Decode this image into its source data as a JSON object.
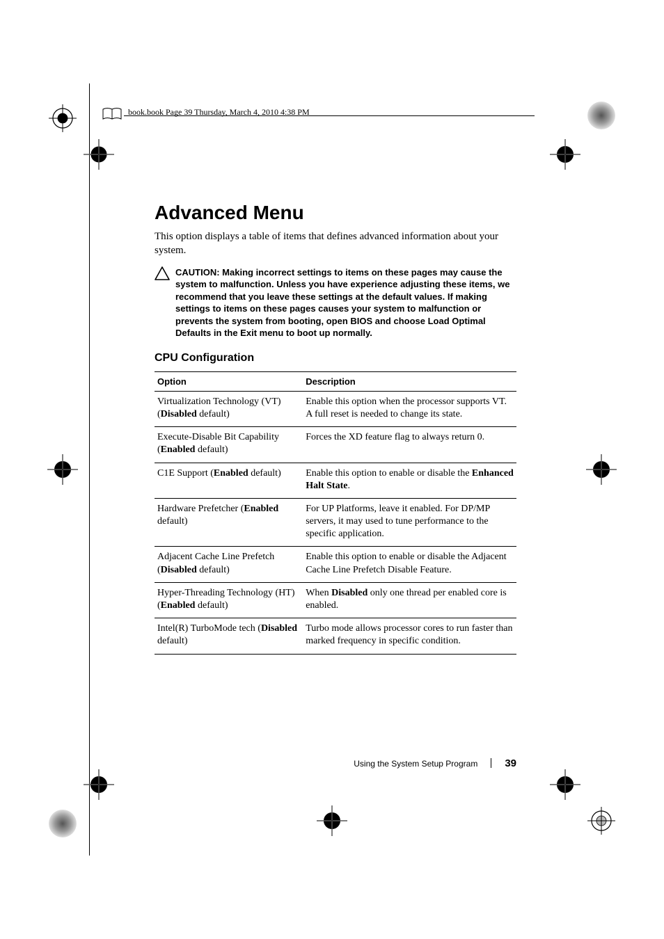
{
  "header": {
    "running_head": "book.book  Page 39  Thursday, March 4, 2010  4:38 PM"
  },
  "title": "Advanced Menu",
  "intro": "This option displays a table of items that defines advanced information about your system.",
  "caution": {
    "lead": "CAUTION:",
    "body": "Making incorrect settings to items on these pages may cause the system to malfunction. Unless you have experience adjusting these items, we recommend that you leave these settings at the default values. If making settings to items on these pages causes your system to malfunction or prevents the system from booting, open BIOS and choose Load Optimal Defaults in the Exit menu to boot up normally."
  },
  "subhead": "CPU Configuration",
  "table": {
    "headers": {
      "option": "Option",
      "description": "Description"
    },
    "rows": [
      {
        "opt_pre": "Virtualization Technology (VT) (",
        "opt_bold": "Disabled",
        "opt_post": " default)",
        "desc_pre": "Enable this option when the processor supports VT. A full reset is needed to change its state.",
        "desc_bold": "",
        "desc_post": ""
      },
      {
        "opt_pre": "Execute-Disable Bit Capability (",
        "opt_bold": "Enabled",
        "opt_post": " default)",
        "desc_pre": "Forces the XD feature flag to always return 0.",
        "desc_bold": "",
        "desc_post": ""
      },
      {
        "opt_pre": "C1E Support (",
        "opt_bold": "Enabled",
        "opt_post": " default)",
        "desc_pre": "Enable this option to enable or disable the ",
        "desc_bold": "Enhanced Halt State",
        "desc_post": "."
      },
      {
        "opt_pre": "Hardware Prefetcher (",
        "opt_bold": "Enabled",
        "opt_post": " default)",
        "desc_pre": "For UP Platforms, leave it enabled. For DP/MP servers, it may used to tune performance to the specific application.",
        "desc_bold": "",
        "desc_post": ""
      },
      {
        "opt_pre": "Adjacent Cache Line Prefetch (",
        "opt_bold": "Disabled",
        "opt_post": " default)",
        "desc_pre": "Enable this option to enable or disable the Adjacent Cache Line Prefetch Disable Feature.",
        "desc_bold": "",
        "desc_post": ""
      },
      {
        "opt_pre": "Hyper-Threading Technology (HT) (",
        "opt_bold": "Enabled",
        "opt_post": " default)",
        "desc_pre": "When ",
        "desc_bold": "Disabled",
        "desc_post": " only one thread per enabled core is enabled."
      },
      {
        "opt_pre": "Intel(R) TurboMode tech (",
        "opt_bold": "Disabled",
        "opt_post": " default)",
        "desc_pre": "Turbo mode allows processor cores to run faster than marked frequency in specific condition.",
        "desc_bold": "",
        "desc_post": ""
      }
    ]
  },
  "footer": {
    "section": "Using the System Setup Program",
    "page": "39"
  }
}
